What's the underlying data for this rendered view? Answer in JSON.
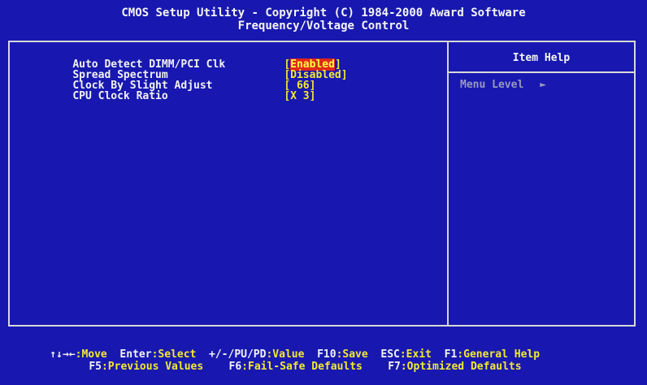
{
  "header": {
    "line1": "CMOS Setup Utility - Copyright (C) 1984-2000 Award Software",
    "line2": "Frequency/Voltage Control"
  },
  "settings": [
    {
      "label": "Auto Detect DIMM/PCI Clk",
      "open": "[",
      "value": "Enabled",
      "close": "]",
      "selected": true
    },
    {
      "label": "Spread Spectrum",
      "open": "[",
      "value": "Disabled",
      "close": "]",
      "selected": false
    },
    {
      "label": "Clock By Slight Adjust",
      "open": "[",
      "value": " 66",
      "close": "]",
      "selected": false
    },
    {
      "label": "CPU Clock Ratio",
      "open": "[",
      "value": "X 3",
      "close": "]",
      "selected": false
    }
  ],
  "help": {
    "title": "Item Help",
    "menu_level_label": "Menu Level",
    "menu_level_marker": "►"
  },
  "footer": {
    "line1": [
      {
        "key": "↑↓→←",
        "desc": ":Move"
      },
      {
        "key": "Enter",
        "desc": ":Select"
      },
      {
        "key": "+/-/PU/PD",
        "desc": ":Value"
      },
      {
        "key": "F10",
        "desc": ":Save"
      },
      {
        "key": "ESC",
        "desc": ":Exit"
      },
      {
        "key": "F1",
        "desc": ":General Help"
      }
    ],
    "line2": [
      {
        "key": "F5",
        "desc": ":Previous Values"
      },
      {
        "key": "F6",
        "desc": ":Fail-Safe Defaults"
      },
      {
        "key": "F7",
        "desc": ":Optimized Defaults"
      }
    ]
  },
  "colors": {
    "background": "#1818b0",
    "value_text": "#f2e830",
    "highlight": "#e02818"
  }
}
